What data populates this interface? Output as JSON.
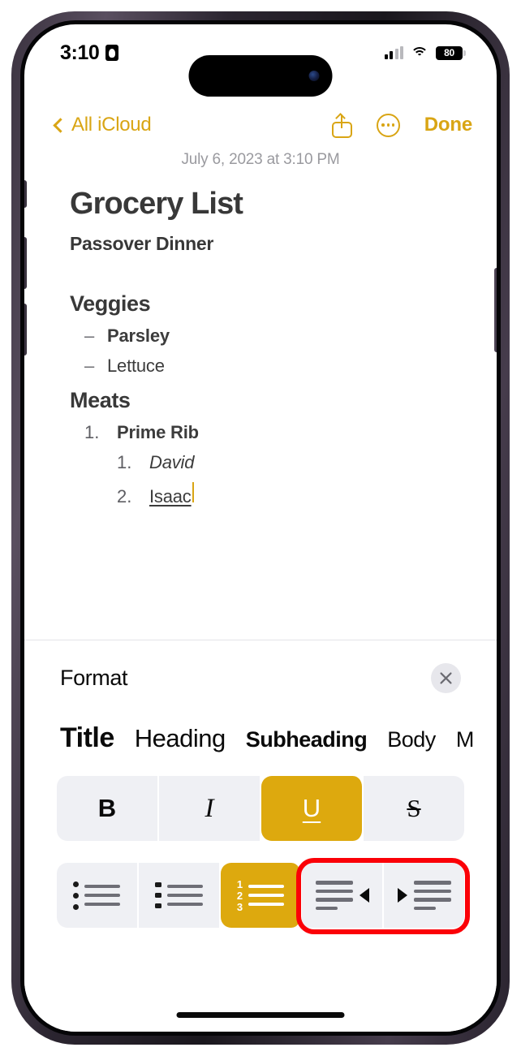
{
  "status_bar": {
    "time": "3:10",
    "location_icon": "location-arrow-icon",
    "cellular_icon": "cellular-bars-icon",
    "wifi_icon": "wifi-icon",
    "battery_percent": "80"
  },
  "nav_bar": {
    "back_label": "All iCloud",
    "back_icon": "chevron-left-icon",
    "share_icon": "share-icon",
    "more_icon": "more-options-icon",
    "done_label": "Done"
  },
  "note": {
    "date": "July 6, 2023 at 3:10 PM",
    "title": "Grocery List",
    "subheading": "Passover Dinner",
    "sections": [
      {
        "heading": "Veggies",
        "items": [
          {
            "marker": "–",
            "text": "Parsley",
            "style": "bold"
          },
          {
            "marker": "–",
            "text": "Lettuce",
            "style": "normal"
          }
        ]
      },
      {
        "heading": "Meats",
        "items": [
          {
            "marker": "1.",
            "text": "Prime Rib",
            "style": "bold",
            "level": 1
          },
          {
            "marker": "1.",
            "text": "David",
            "style": "italic",
            "level": 2
          },
          {
            "marker": "2.",
            "text": "Isaac",
            "style": "underline",
            "level": 2
          }
        ]
      }
    ]
  },
  "format_panel": {
    "title": "Format",
    "close_icon": "close-icon",
    "styles": [
      {
        "key": "title",
        "label": "Title"
      },
      {
        "key": "heading",
        "label": "Heading"
      },
      {
        "key": "subheading",
        "label": "Subheading"
      },
      {
        "key": "body",
        "label": "Body"
      },
      {
        "key": "monostyled",
        "label": "M"
      }
    ],
    "text_format": [
      {
        "key": "bold",
        "label": "B",
        "active": false
      },
      {
        "key": "italic",
        "label": "I",
        "active": false
      },
      {
        "key": "underline",
        "label": "U",
        "active": true
      },
      {
        "key": "strikethrough",
        "label": "S",
        "active": false
      }
    ],
    "list_controls": [
      {
        "key": "bulleted-list",
        "icon": "bulleted-list-icon",
        "active": false
      },
      {
        "key": "dashed-list",
        "icon": "dashed-list-icon",
        "active": false
      },
      {
        "key": "numbered-list",
        "icon": "numbered-list-icon",
        "active": true
      },
      {
        "key": "outdent",
        "icon": "outdent-icon",
        "active": false
      },
      {
        "key": "indent",
        "icon": "indent-icon",
        "active": false
      }
    ],
    "numbered_list_digits": [
      "1",
      "2",
      "3"
    ]
  },
  "annotation": {
    "highlight_color": "#fb0007",
    "highlight_target": "indent-outdent-buttons"
  },
  "colors": {
    "accent_gold": "#D9A514",
    "active_gold": "#DDA90E",
    "annotation_red": "#fb0007",
    "segment_bg": "#eff0f4",
    "text_dark": "#383838"
  }
}
